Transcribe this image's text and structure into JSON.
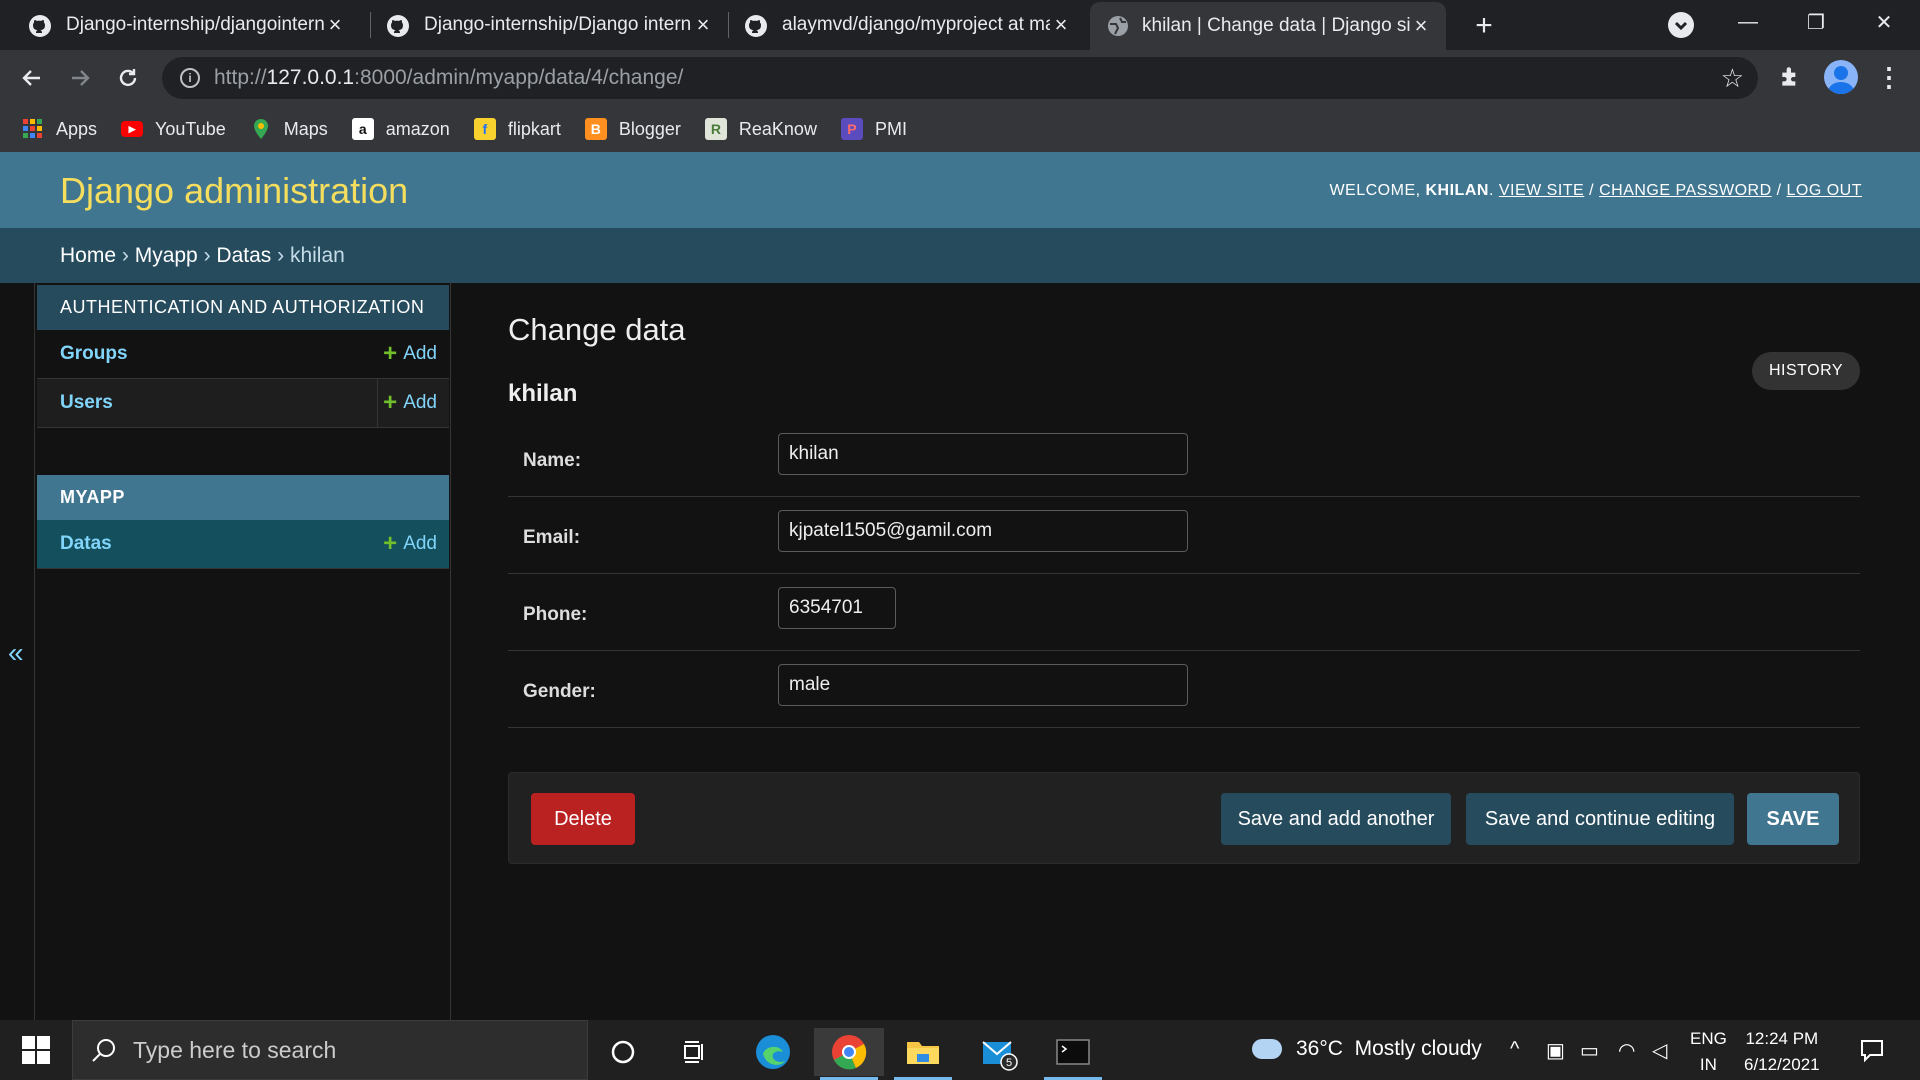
{
  "browser": {
    "tabs": [
      {
        "title": "Django-internship/djangointernship",
        "favicon": "github-icon"
      },
      {
        "title": "Django-internship/Django internship",
        "favicon": "github-icon"
      },
      {
        "title": "alaymvd/django/myproject at main",
        "favicon": "github-icon"
      },
      {
        "title": "khilan | Change data | Django site admin",
        "favicon": "globe-icon",
        "active": true
      }
    ],
    "url_scheme": "http://",
    "url_host": "127.0.0.1",
    "url_rest": ":8000/admin/myapp/data/4/change/",
    "bookmarks": [
      {
        "label": "Apps",
        "icon": "apps-grid-icon",
        "color": "#ea4335"
      },
      {
        "label": "YouTube",
        "icon": "youtube-icon",
        "color": "#ff0000"
      },
      {
        "label": "Maps",
        "icon": "maps-icon",
        "color": "#34a853"
      },
      {
        "label": "amazon",
        "icon": "amazon-icon",
        "color": "#ffffff"
      },
      {
        "label": "flipkart",
        "icon": "flipkart-icon",
        "color": "#f8d12f"
      },
      {
        "label": "Blogger",
        "icon": "blogger-icon",
        "color": "#ff8f1f"
      },
      {
        "label": "ReaKnow",
        "icon": "reaknow-icon",
        "color": "#dfe6d9"
      },
      {
        "label": "PMI",
        "icon": "pmi-icon",
        "color": "#7b68ee"
      }
    ]
  },
  "header": {
    "branding": "Django administration",
    "welcome": "WELCOME, ",
    "username": "KHILAN",
    "view_site": "VIEW SITE",
    "change_password": "CHANGE PASSWORD",
    "log_out": "LOG OUT",
    "separator": " / "
  },
  "breadcrumbs": {
    "home": "Home",
    "app": "Myapp",
    "model": "Datas",
    "object": "khilan",
    "sep": " › "
  },
  "sidebar": {
    "toggle": "«",
    "modules": [
      {
        "caption": "AUTHENTICATION AND AUTHORIZATION",
        "rows": [
          {
            "label": "Groups",
            "add": "Add"
          },
          {
            "label": "Users",
            "add": "Add"
          }
        ]
      },
      {
        "caption": "MYAPP",
        "rows": [
          {
            "label": "Datas",
            "add": "Add",
            "current": true
          }
        ]
      }
    ]
  },
  "content": {
    "title": "Change data",
    "object_name": "khilan",
    "history": "HISTORY",
    "fields": [
      {
        "label": "Name:",
        "value": "khilan"
      },
      {
        "label": "Email:",
        "value": "kjpatel1505@gamil.com"
      },
      {
        "label": "Phone:",
        "value": "6354701"
      },
      {
        "label": "Gender:",
        "value": "male"
      }
    ],
    "buttons": {
      "delete": "Delete",
      "save_add_another": "Save and add another",
      "save_continue": "Save and continue editing",
      "save": "SAVE"
    }
  },
  "taskbar": {
    "search_placeholder": "Type here to search",
    "weather": "36°C  Mostly cloudy",
    "lang_top": "ENG",
    "lang_bottom": "IN",
    "time": "12:24 PM",
    "date": "6/12/2021",
    "mail_badge": "5"
  },
  "colors": {
    "header_bg": "#417690",
    "branding": "#f5dd5d",
    "breadcrumb_bg": "#264b5d",
    "link": "#81d4fa",
    "add_plus": "#70bf2b",
    "delete": "#ba2121"
  }
}
